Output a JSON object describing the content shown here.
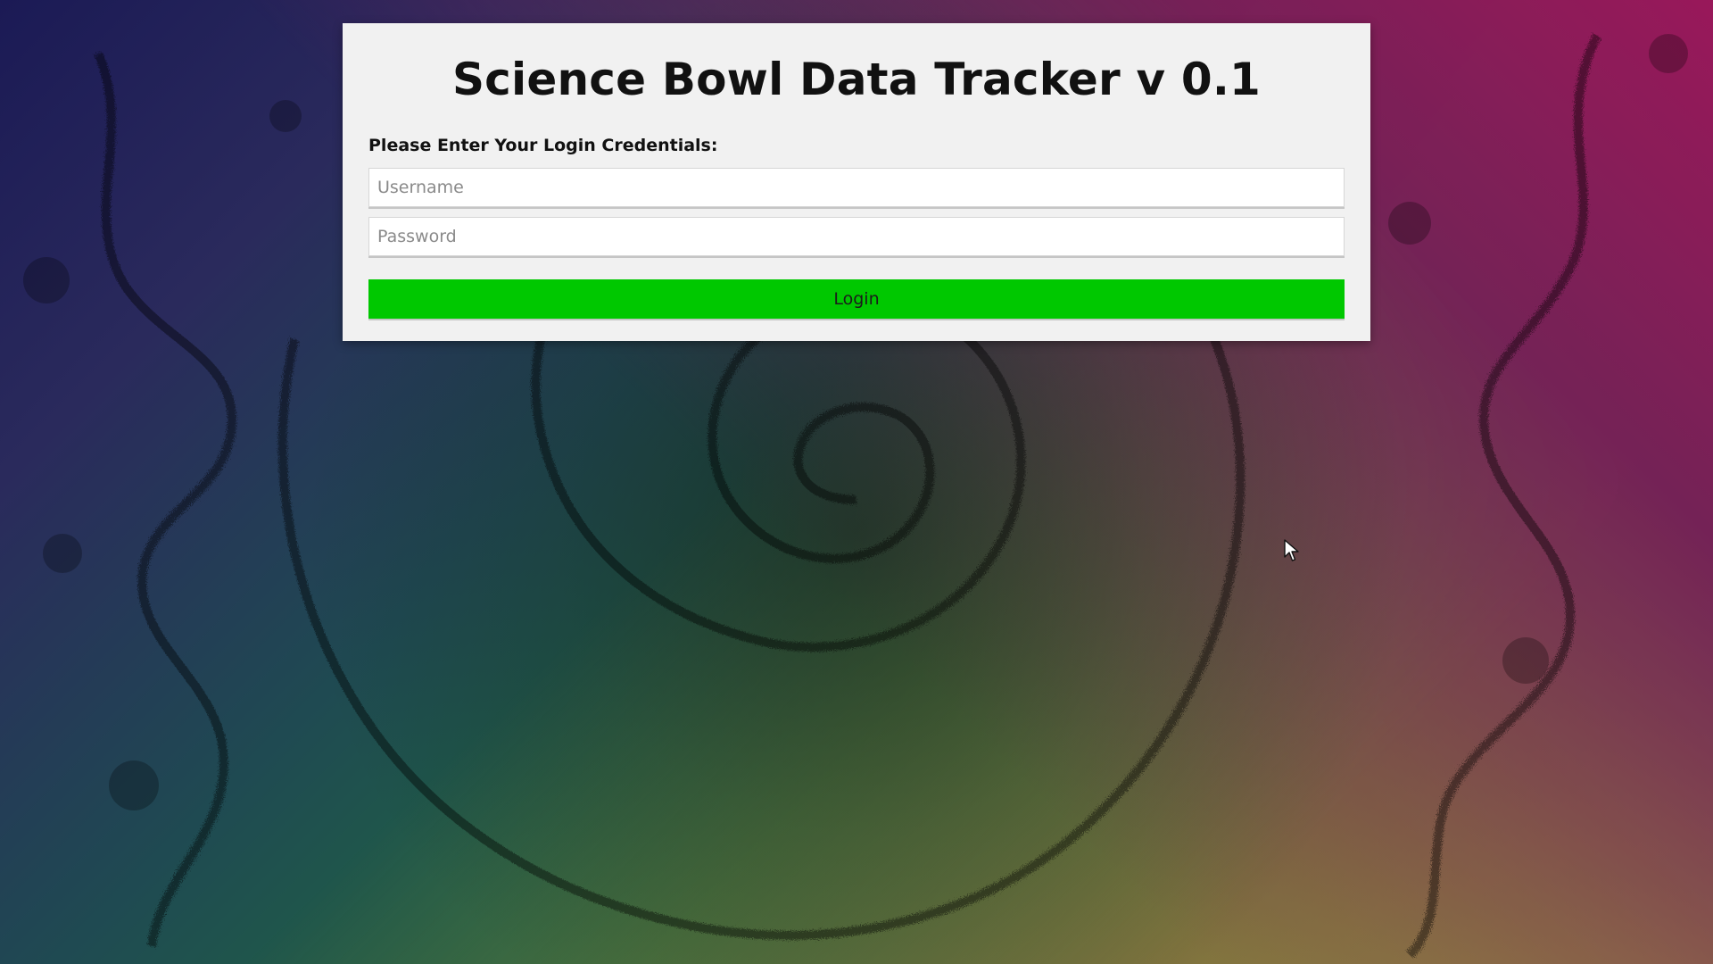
{
  "app": {
    "title": "Science Bowl Data Tracker v 0.1"
  },
  "login": {
    "prompt": "Please Enter Your Login Credentials:",
    "username_placeholder": "Username",
    "password_placeholder": "Password",
    "username_value": "",
    "password_value": "",
    "login_label": "Login"
  },
  "colors": {
    "panel": "#f1f1f1",
    "button": "#00c800",
    "title_text": "#111111"
  },
  "icons": {
    "cursor": "mouse-pointer-icon"
  }
}
